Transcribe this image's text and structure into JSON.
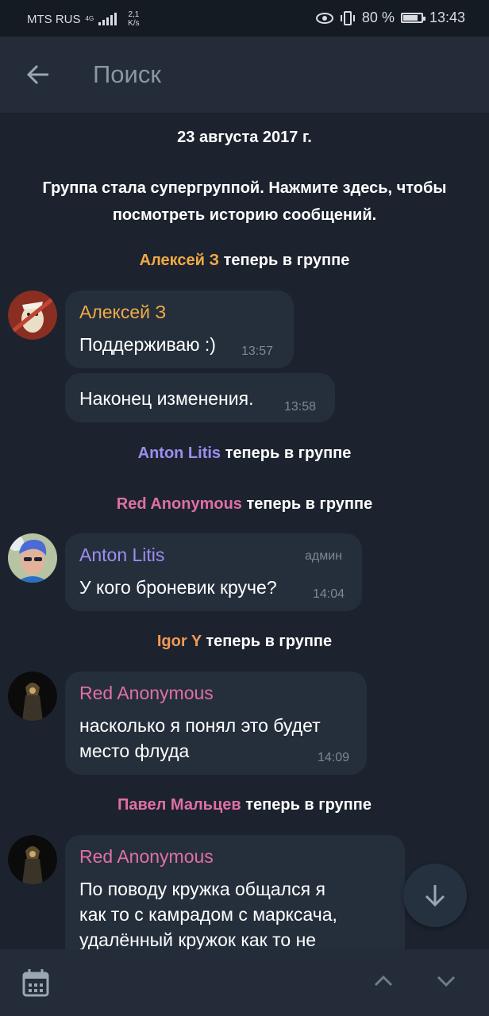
{
  "status_bar": {
    "carrier": "MTS RUS",
    "network": "4G",
    "speed_value": "2,1",
    "speed_unit": "K/s",
    "battery": "80 %",
    "battery_level": 0.8,
    "time": "13:43"
  },
  "header": {
    "back_icon": "arrow-left-icon",
    "search_placeholder": "Поиск"
  },
  "chat": {
    "date": "23 августа 2017 г.",
    "supergroup_notice": "Группа стала супергруппой. Нажмите здесь, чтобы посмотреть историю сообщений.",
    "joined_suffix": "теперь в группе",
    "events": [
      {
        "name": "Алексей З",
        "color": "#f2a945"
      },
      {
        "name": "Anton Litis",
        "color": "#9b8ef0"
      },
      {
        "name": "Red Anonymous",
        "color": "#e06fa6"
      },
      {
        "name": "Igor Y",
        "color": "#f29a55"
      },
      {
        "name": "Павел Мальцев",
        "color": "#e06fa6"
      }
    ],
    "messages": [
      {
        "sender": "Алексей З",
        "color": "#f2a945",
        "text": "Поддерживаю :)",
        "time": "13:57"
      },
      {
        "text": "Наконец изменения.",
        "time": "13:58"
      },
      {
        "sender": "Anton Litis",
        "color": "#9b8ef0",
        "role": "админ",
        "text": "У кого броневик круче?",
        "time": "14:04"
      },
      {
        "sender": "Red Anonymous",
        "color": "#e06fa6",
        "text_line1": "насколько я понял это будет",
        "text_line2": "место флуда",
        "time": "14:09"
      },
      {
        "sender": "Red Anonymous",
        "color": "#e06fa6",
        "text_line1": "По поводу кружка общался я",
        "text_line2": "как то с камрадом с марксача,",
        "text_line3": "удалённый кружок как то не"
      }
    ]
  },
  "fab": {
    "icon": "arrow-down-icon"
  },
  "bottom_bar": {
    "calendar_icon": "calendar-icon",
    "up_icon": "chevron-up-icon",
    "down_icon": "chevron-down-icon"
  }
}
